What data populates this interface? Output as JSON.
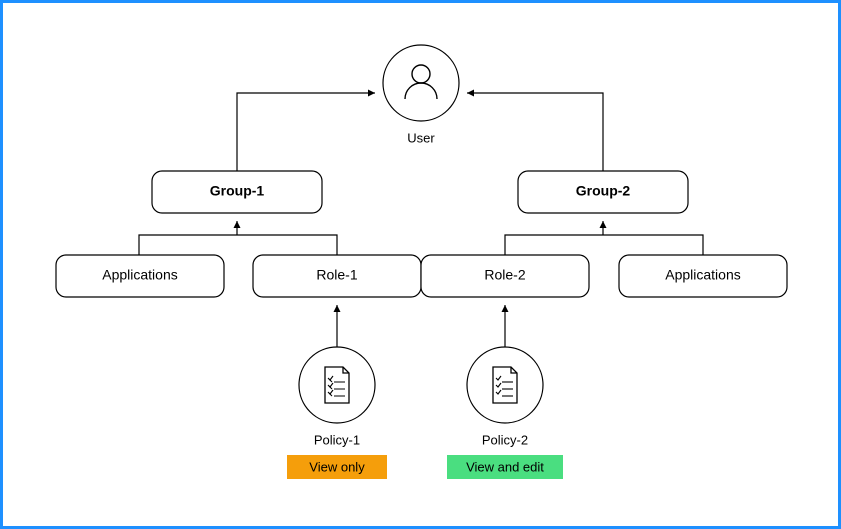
{
  "user": {
    "label": "User"
  },
  "group1": {
    "label": "Group-1"
  },
  "group2": {
    "label": "Group-2"
  },
  "applications_left": {
    "label": "Applications"
  },
  "applications_right": {
    "label": "Applications"
  },
  "role1": {
    "label": "Role-1"
  },
  "role2": {
    "label": "Role-2"
  },
  "policy1": {
    "label": "Policy-1",
    "badge": "View only"
  },
  "policy2": {
    "label": "Policy-2",
    "badge": "View and edit"
  },
  "colors": {
    "view_only_bg": "#f59e0b",
    "view_edit_bg": "#4ade80",
    "frame_border": "#1e90ff"
  }
}
